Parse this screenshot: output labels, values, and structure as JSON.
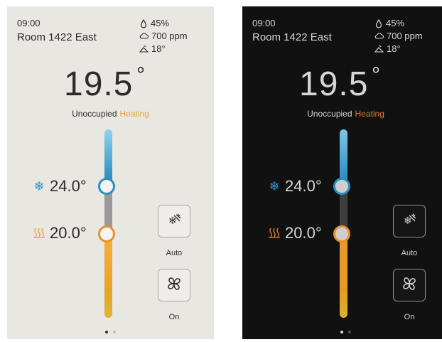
{
  "panels": [
    {
      "theme": "light",
      "time": "09:00",
      "room": "Room 1422 East",
      "humidity": "45%",
      "co2": "700 ppm",
      "outdoor_temp": "18°",
      "temperature": "19.5",
      "degree_symbol": "°",
      "occupancy": "Unoccupied",
      "state": "Heating",
      "cool_setpoint": "24.0°",
      "heat_setpoint": "20.0°",
      "mode_label": "Auto",
      "fan_label": "On",
      "page_indicator": {
        "current": 1,
        "total": 2
      }
    },
    {
      "theme": "dark",
      "time": "09:00",
      "room": "Room 1422 East",
      "humidity": "45%",
      "co2": "700 ppm",
      "outdoor_temp": "18°",
      "temperature": "19.5",
      "degree_symbol": "°",
      "occupancy": "Unoccupied",
      "state": "Heating",
      "cool_setpoint": "24.0°",
      "heat_setpoint": "20.0°",
      "mode_label": "Auto",
      "fan_label": "On",
      "page_indicator": {
        "current": 1,
        "total": 2
      }
    }
  ],
  "icons": {
    "humidity": "droplet-icon",
    "co2": "cloud-icon",
    "outdoor": "outdoor-temperature-icon",
    "cool": "snowflake-icon",
    "heat": "heat-waves-icon",
    "mode": "auto-mode-icon",
    "fan": "fan-icon"
  },
  "colors": {
    "cool_accent": "#2c8fc0",
    "heat_accent": "#e8a33a",
    "light_bg": "#e8e7e2",
    "dark_bg": "#111111"
  }
}
